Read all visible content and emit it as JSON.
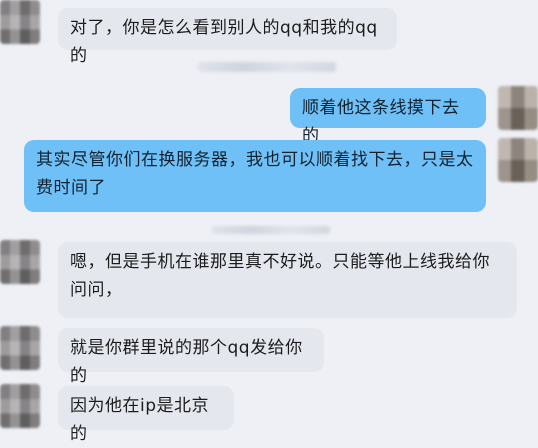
{
  "conversation": {
    "messages": [
      {
        "side": "in",
        "text": "对了，你是怎么看到别人的qq和我的qq的"
      },
      {
        "side": "out",
        "text": "顺着他这条线摸下去的"
      },
      {
        "side": "out",
        "text": "其实尽管你们在换服务器，我也可以顺着找下去，只是太费时间了"
      },
      {
        "side": "in",
        "text": "嗯，但是手机在谁那里真不好说。只能等他上线我给你问问，"
      },
      {
        "side": "in",
        "text": "就是你群里说的那个qq发给你的"
      },
      {
        "side": "in",
        "text": "因为他在ip是北京的"
      }
    ]
  },
  "colors": {
    "background": "#eef0f5",
    "incoming_bubble": "#e4e7ee",
    "outgoing_bubble": "#6ec0f6"
  }
}
